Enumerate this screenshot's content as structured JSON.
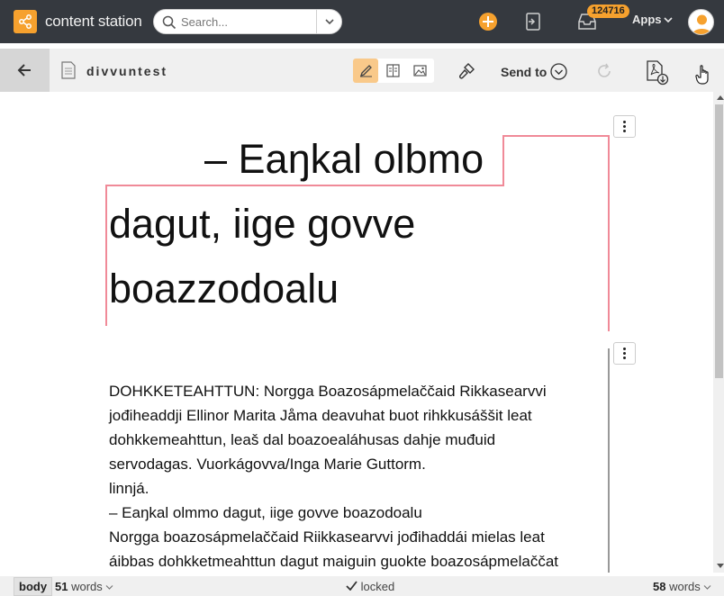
{
  "app": {
    "brand": "content station"
  },
  "search": {
    "placeholder": "Search..."
  },
  "inbox": {
    "count": "124716"
  },
  "apps": {
    "label": "Apps"
  },
  "toolbar": {
    "document_name": "divvuntest",
    "send_to_label": "Send to"
  },
  "article": {
    "headline_line1": "– Eaŋkal olbmo",
    "headline_line2": "dagut, iige govve",
    "headline_line3": "boazzodoalu",
    "body_lines": [
      "DOHKKETEAHTTUN: Norgga Boazosápmelaččaid Rikkasearvvi",
      "jođiheaddji Ellinor Marita Jåma deavuhat buot rihkkusáššit leat",
      "dohkkemeahttun, leaš dal boazoealáhusas dahje muđuid",
      "servodagas. Vuorkágovva/Inga Marie Guttorm.",
      "linnjá.",
      "– Eaŋkal olmmo dagut, iige govve boazodoalu",
      "Norgga boazosápmelaččaid Riikkasearvvi jođihaddái mielas leat",
      "áibbas dohkketmeahttun dagut maiguin guokte boazosápmelaččat"
    ]
  },
  "status": {
    "component": "body",
    "component_words_count": "51",
    "component_words_unit": "words",
    "lock_state": "locked",
    "total_words_count": "58",
    "total_words_unit": "words"
  },
  "colors": {
    "topbar": "#35393f",
    "accent": "#f6a12e",
    "toolbar": "#f0f0f0",
    "active_mode": "#f9c98a",
    "frame_pink": "#f08a98"
  },
  "icons": [
    "logo-icon",
    "search-icon",
    "chevron-down-icon",
    "plus-icon",
    "exit-icon",
    "inbox-icon",
    "user-avatar-icon",
    "arrow-left-icon",
    "document-icon",
    "pencil-icon",
    "preview-icon",
    "image-icon",
    "brush-icon",
    "refresh-icon",
    "pdf-download-icon",
    "hand-pointer-icon",
    "kebab-icon",
    "check-icon"
  ]
}
